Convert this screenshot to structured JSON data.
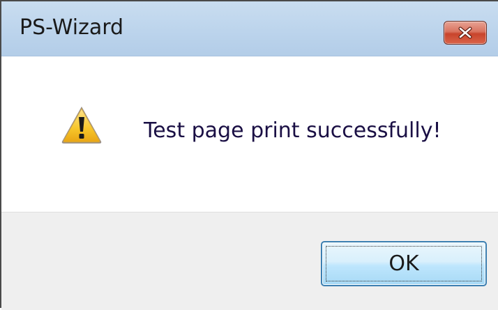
{
  "window": {
    "title": "PS-Wizard",
    "close_icon": "close-x-icon"
  },
  "dialog": {
    "icon": "warning-icon",
    "message": "Test page print successfully!"
  },
  "buttons": {
    "ok_label": "OK"
  },
  "colors": {
    "titlebar": "#bcd4ec",
    "close_button": "#c8442b",
    "message_text": "#1a0f44",
    "footer": "#efefef",
    "ok_border": "#3c7fb1",
    "warning_fill": "#f7c62a"
  }
}
